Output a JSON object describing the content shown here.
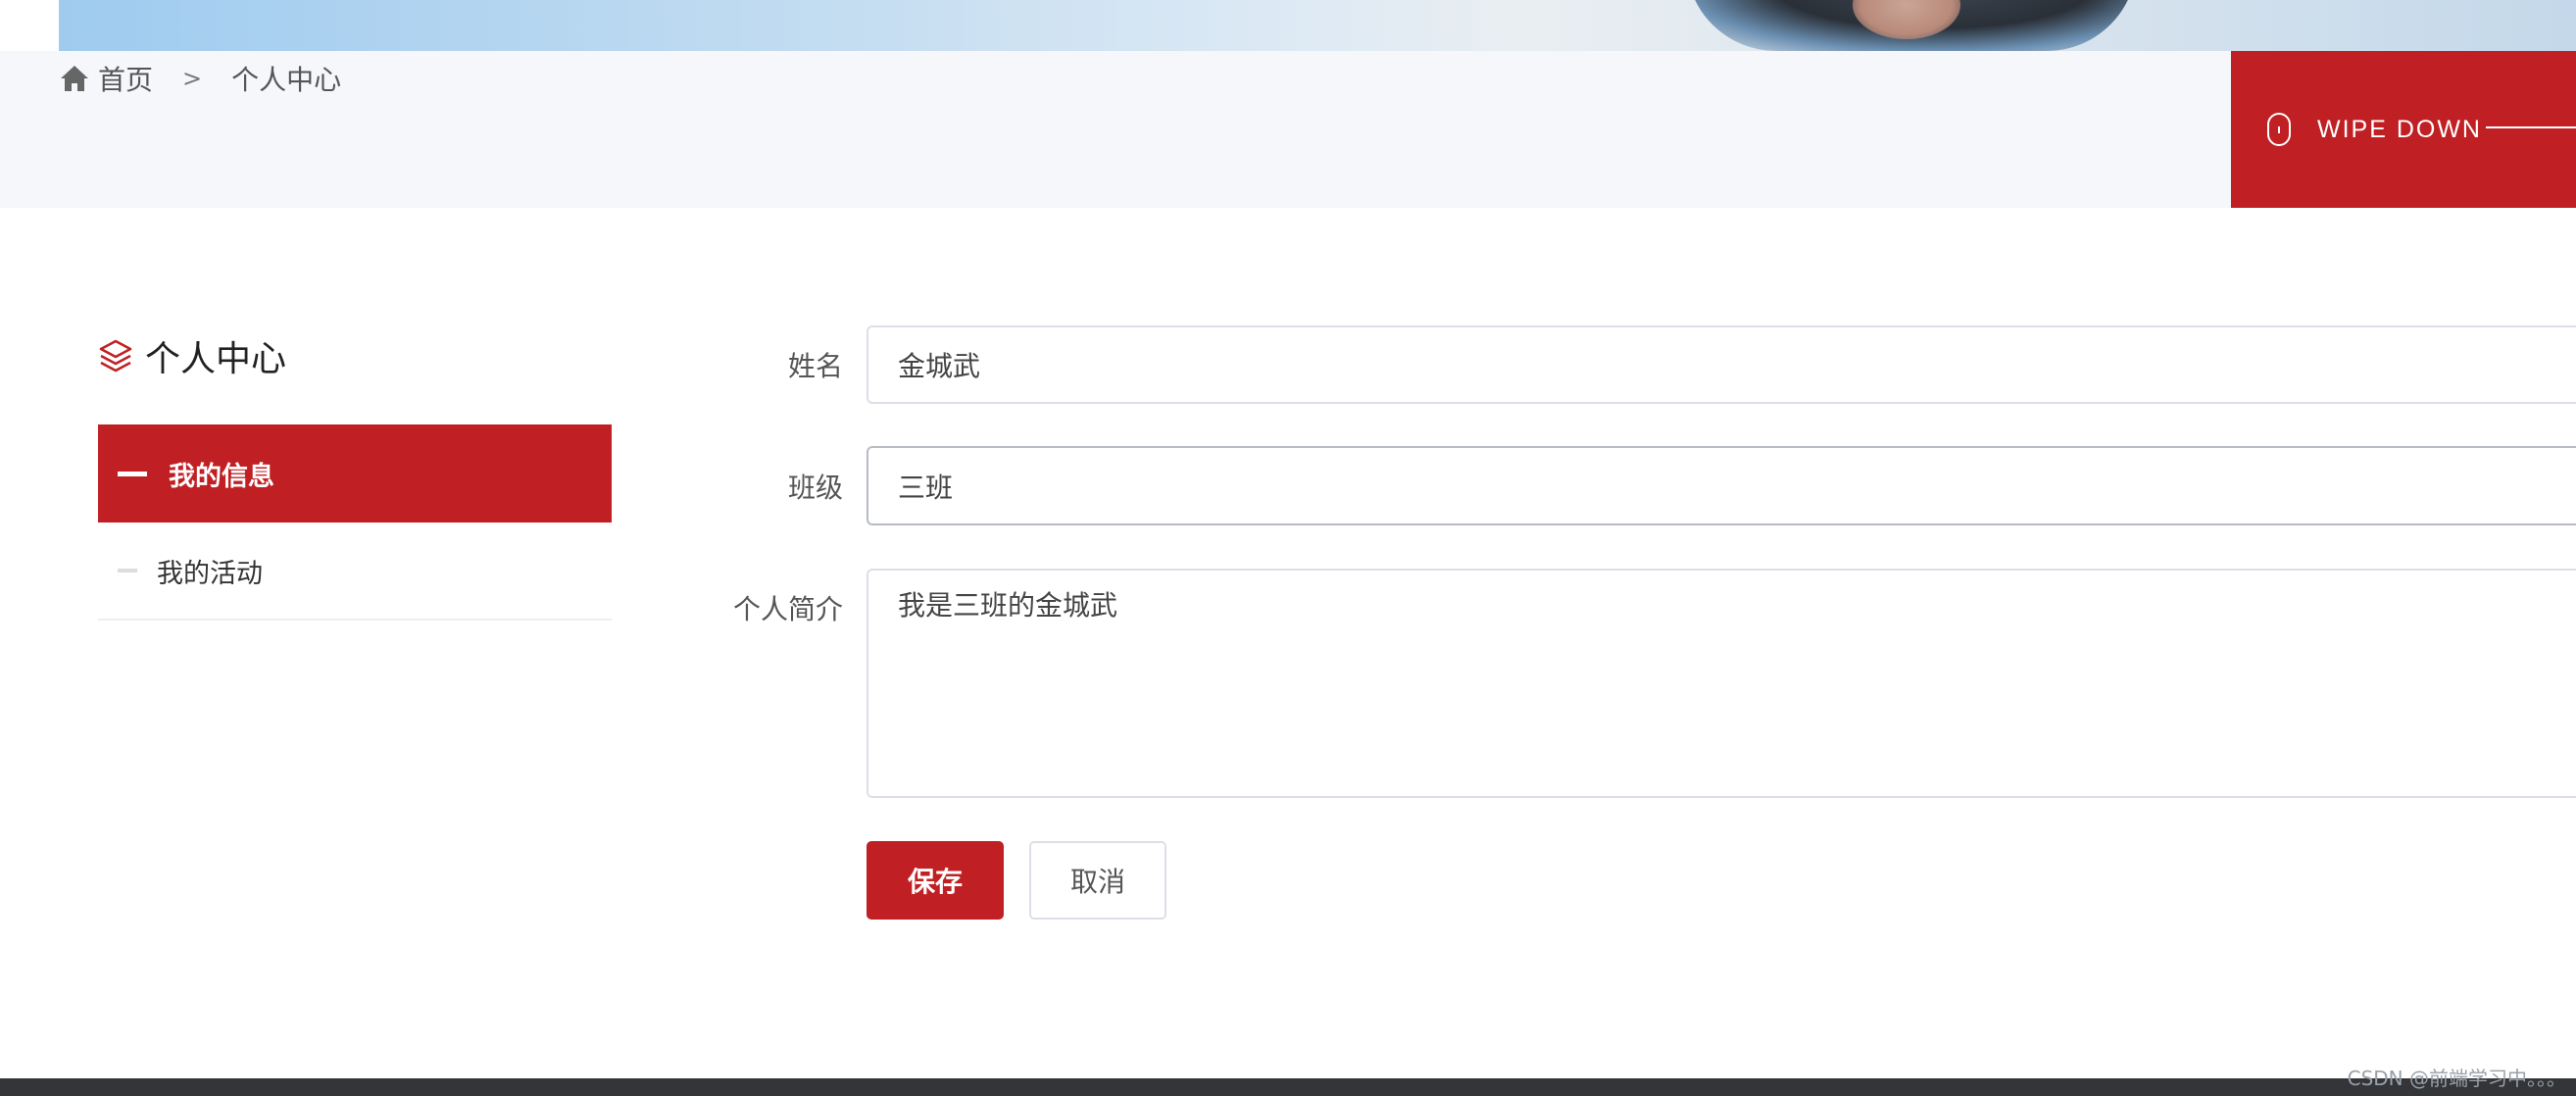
{
  "breadcrumb": {
    "home_icon": "home-icon",
    "home": "首页",
    "separator": ">",
    "current": "个人中心"
  },
  "wipe": {
    "icon": "mouse-icon",
    "label": "WIPE DOWN"
  },
  "sidebar": {
    "title_icon": "layers-icon",
    "title": "个人中心",
    "items": [
      {
        "label": "我的信息",
        "active": true
      },
      {
        "label": "我的活动",
        "active": false
      }
    ]
  },
  "form": {
    "name_label": "姓名",
    "name_value": "金城武",
    "class_label": "班级",
    "class_value": "三班",
    "intro_label": "个人简介",
    "intro_value": "我是三班的金城武",
    "save_label": "保存",
    "cancel_label": "取消"
  },
  "footer": {
    "watermark": "CSDN @前端学习中。。。"
  },
  "colors": {
    "accent": "#c02024",
    "bar_bg": "#f5f7fa",
    "footer": "#333538"
  }
}
